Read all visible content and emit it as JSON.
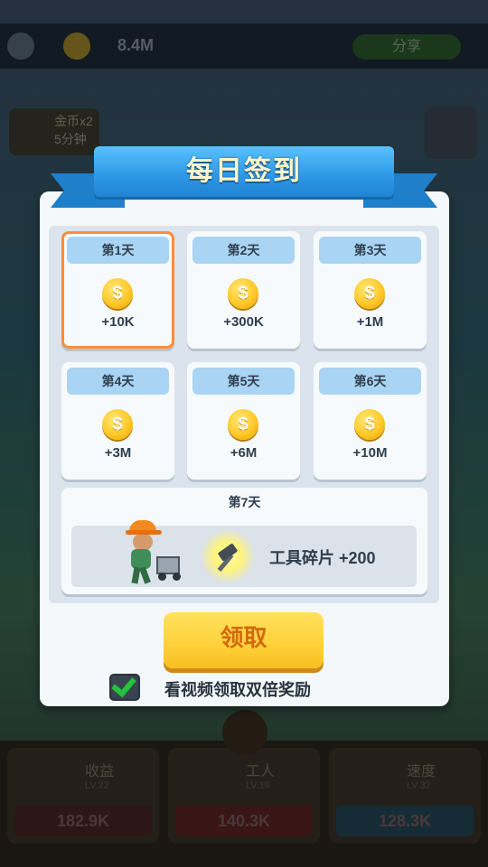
{
  "background": {
    "money": "8.4M",
    "top_button": "分享",
    "boost_title": "金币x2",
    "boost_time": "5分钟",
    "cards": [
      {
        "title": "收益",
        "level": "LV.22",
        "value": "182.9K",
        "pill_color": "#4a2424"
      },
      {
        "title": "工人",
        "level": "LV.19",
        "value": "140.3K",
        "pill_color": "#5c2222"
      },
      {
        "title": "速度",
        "level": "LV.32",
        "value": "128.3K",
        "pill_color": "#23485a"
      }
    ]
  },
  "dialog": {
    "title": "每日签到",
    "days": [
      {
        "label": "第1天",
        "amount": "+10K",
        "active": true
      },
      {
        "label": "第2天",
        "amount": "+300K",
        "active": false
      },
      {
        "label": "第3天",
        "amount": "+1M",
        "active": false
      },
      {
        "label": "第4天",
        "amount": "+3M",
        "active": false
      },
      {
        "label": "第5天",
        "amount": "+6M",
        "active": false
      },
      {
        "label": "第6天",
        "amount": "+10M",
        "active": false
      }
    ],
    "coin_symbol": "$",
    "day7": {
      "label": "第7天",
      "reward": "工具碎片 +200"
    },
    "claim_button": "领取",
    "video_option": {
      "checked": true,
      "label": "看视频领取双倍奖励"
    }
  },
  "colors": {
    "ribbon": "#2f9ae8",
    "active_border": "#ff8c3a",
    "claim_button": "#ffd13a",
    "check": "#22c33a"
  }
}
